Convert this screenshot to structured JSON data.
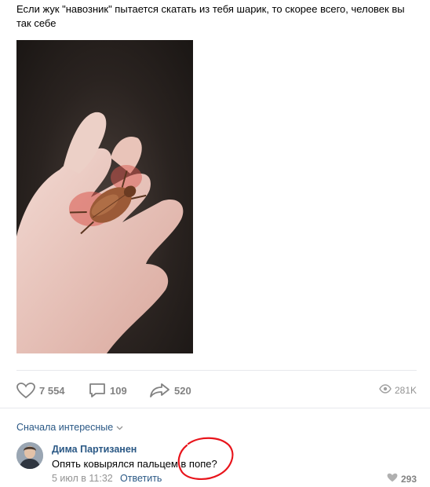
{
  "post": {
    "text": "Если жук \"навозник\" пытается скатать из тебя шарик, то скорее всего, человек вы так себе"
  },
  "actions": {
    "likes": "7 554",
    "comments": "109",
    "shares": "520",
    "views": "281K"
  },
  "comments_section": {
    "sort_label": "Сначала интересные"
  },
  "comment": {
    "author": "Дима Партизанен",
    "text": "Опять ковырялся пальцем в попе?",
    "date": "5 июл в 11:32",
    "reply_label": "Ответить",
    "likes": "293"
  },
  "icons": {
    "like": "heart-icon",
    "comment": "comment-icon",
    "share": "share-arrow-icon",
    "views": "eye-icon",
    "sort": "chevron-down-icon"
  },
  "colors": {
    "link": "#2a5885",
    "muted": "#939393",
    "icon": "#828282",
    "annotation": "#e8141b"
  }
}
